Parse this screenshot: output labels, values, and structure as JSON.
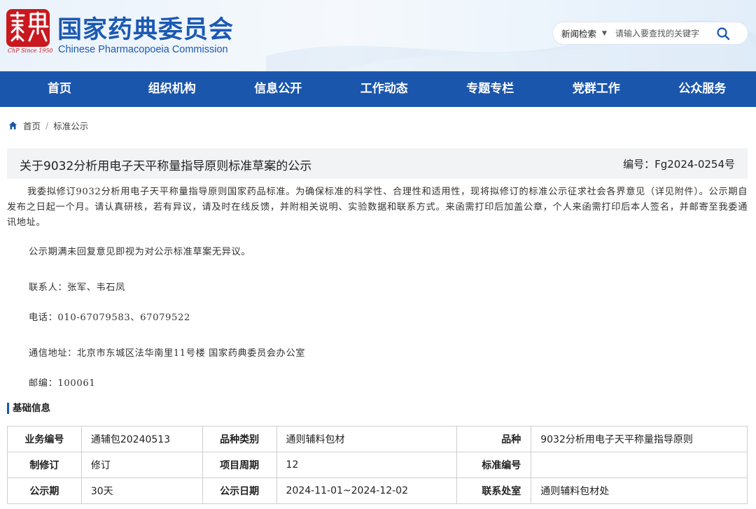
{
  "header": {
    "seal_text": "藥典",
    "seal_caption": "ChP Since 1950",
    "title_cn": "国家药典委员会",
    "title_en": "Chinese Pharmacopoeia Commission",
    "accent_color": "#1b56ad",
    "seal_color": "#c9181e"
  },
  "search": {
    "scope": "新闻检索",
    "placeholder": "请输入要查找的关键字",
    "icon": "search-icon"
  },
  "nav": {
    "items": [
      "首页",
      "组织机构",
      "信息公开",
      "工作动态",
      "专题专栏",
      "党群工作",
      "公众服务"
    ]
  },
  "breadcrumb": {
    "icon": "home-icon",
    "home": "首页",
    "separator": "/",
    "current": "标准公示"
  },
  "article": {
    "title": "关于9032分析用电子天平称量指导原则标准草案的公示",
    "number": "编号：Fg2024-0254号",
    "paragraph1": "我委拟修订9032分析用电子天平称量指导原则国家药品标准。为确保标准的科学性、合理性和适用性，现将拟修订的标准公示征求社会各界意见（详见附件）。公示期自发布之日起一个月。请认真研核，若有异议，请及时在线反馈，并附相关说明、实验数据和联系方式。来函需打印后加盖公章，个人来函需打印后本人签名，并邮寄至我委通讯地址。",
    "paragraph2": "公示期满未回复意见即视为对公示标准草案无异议。",
    "contact": "联系人：张军、韦石凤",
    "phone": "电话：010-67079583、67079522",
    "address": "通信地址：北京市东城区法华南里11号楼 国家药典委员会办公室",
    "postcode": "邮编：100061"
  },
  "basic_info": {
    "heading": "基础信息",
    "rows": [
      [
        {
          "k": "业务编号",
          "v": "通辅包20240513"
        },
        {
          "k": "品种类别",
          "v": "通则辅料包材"
        },
        {
          "k": "品种",
          "v": "9032分析用电子天平称量指导原则"
        }
      ],
      [
        {
          "k": "制修订",
          "v": "修订"
        },
        {
          "k": "项目周期",
          "v": "12"
        },
        {
          "k": "标准编号",
          "v": ""
        }
      ],
      [
        {
          "k": "公示期",
          "v": "30天"
        },
        {
          "k": "公示日期",
          "v": "2024-11-01~2024-12-02"
        },
        {
          "k": "联系处室",
          "v": "通则辅料包材处"
        }
      ]
    ]
  }
}
